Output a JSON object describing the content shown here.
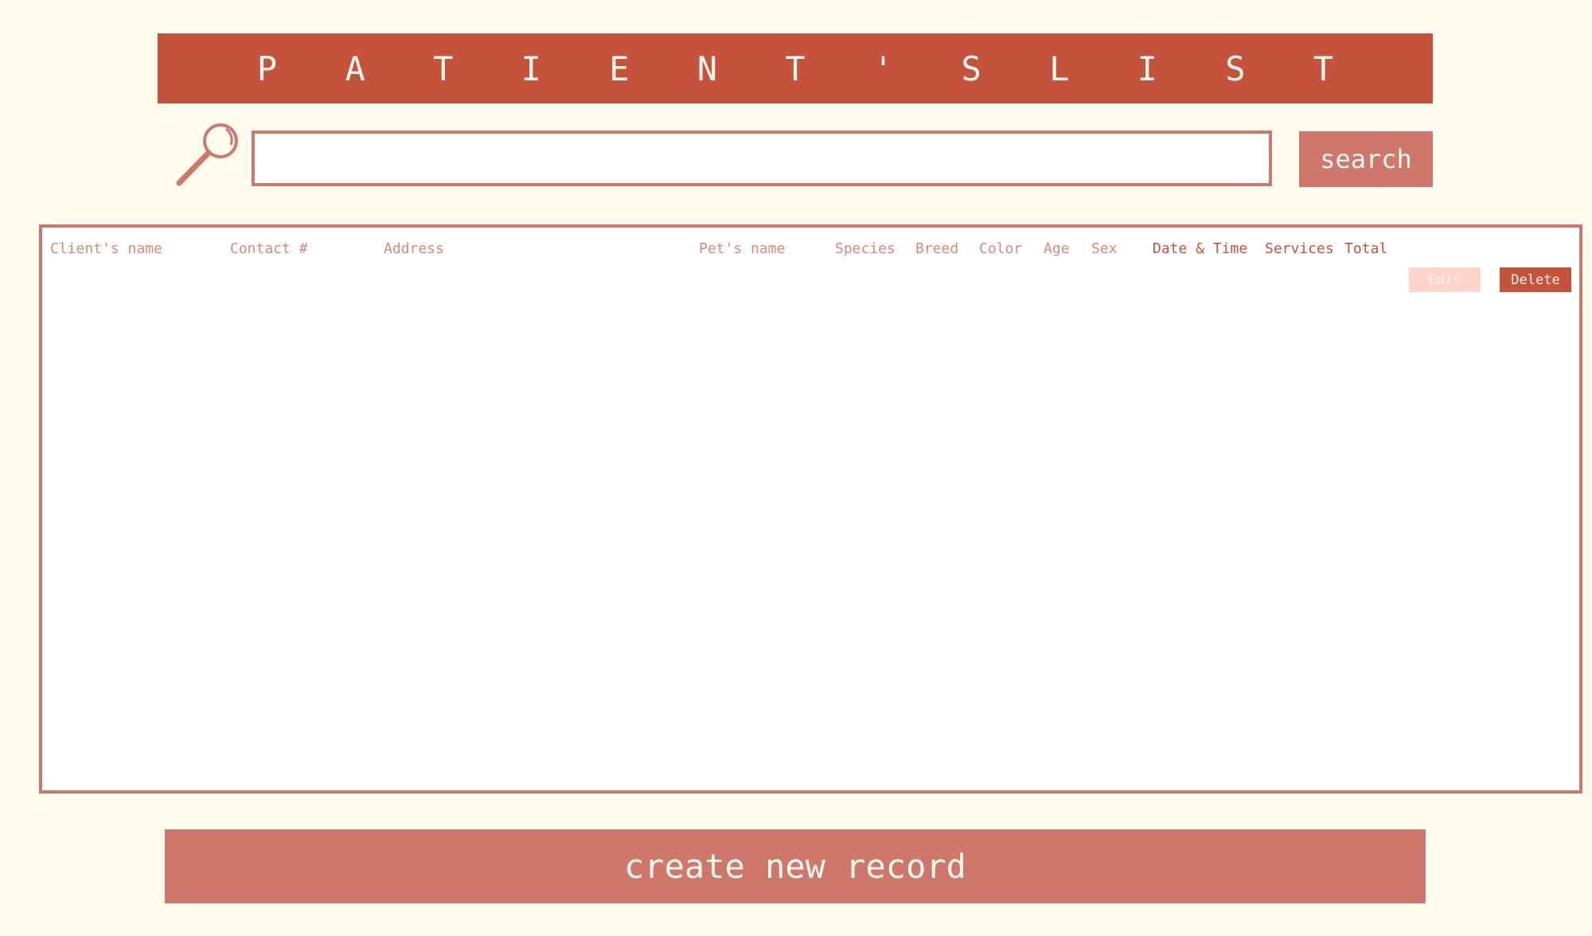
{
  "header": {
    "title": "P A T I E N T ' S   L I S T"
  },
  "search": {
    "icon": "magnifying-glass-icon",
    "value": "",
    "placeholder": "",
    "button_label": "search"
  },
  "table": {
    "columns": [
      "Client's name",
      "Contact #",
      "Address",
      "Pet's name",
      "Species",
      "Breed",
      "Color",
      "Age",
      "Sex",
      "Date & Time",
      "Services",
      "Total"
    ],
    "rows": [],
    "row_actions": {
      "edit_label": "Edit",
      "delete_label": "Delete"
    }
  },
  "footer": {
    "create_label": "create new record"
  },
  "colors": {
    "background": "#fffcee",
    "primary": "#c5533b",
    "secondary": "#cf776a",
    "muted": "#ffd5cb"
  }
}
